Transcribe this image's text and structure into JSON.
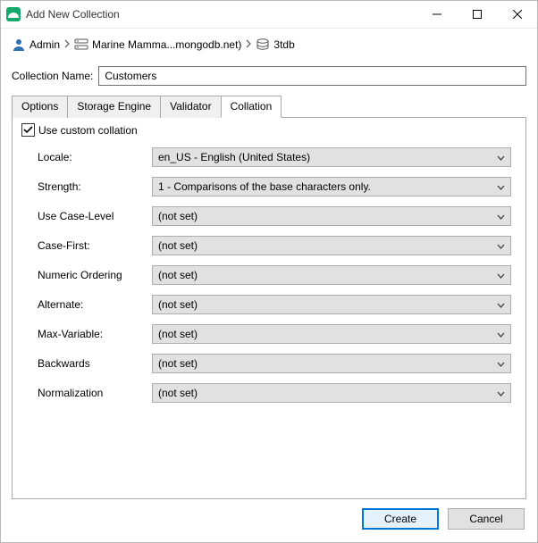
{
  "window": {
    "title": "Add New Collection"
  },
  "breadcrumb": {
    "items": [
      {
        "label": "Admin"
      },
      {
        "label": "Marine Mamma...mongodb.net)"
      },
      {
        "label": "3tdb"
      }
    ]
  },
  "collection_name": {
    "label": "Collection Name:",
    "value": "Customers"
  },
  "tabs": [
    {
      "label": "Options"
    },
    {
      "label": "Storage Engine"
    },
    {
      "label": "Validator"
    },
    {
      "label": "Collation"
    }
  ],
  "active_tab_index": 3,
  "collation": {
    "checkbox_label": "Use custom collation",
    "checked": true,
    "fields": [
      {
        "label": "Locale:",
        "value": "en_US - English (United States)"
      },
      {
        "label": "Strength:",
        "value": "1 - Comparisons of the base characters only."
      },
      {
        "label": "Use Case-Level",
        "value": "(not set)"
      },
      {
        "label": "Case-First:",
        "value": "(not set)"
      },
      {
        "label": "Numeric Ordering",
        "value": "(not set)"
      },
      {
        "label": "Alternate:",
        "value": "(not set)"
      },
      {
        "label": "Max-Variable:",
        "value": "(not set)"
      },
      {
        "label": "Backwards",
        "value": "(not set)"
      },
      {
        "label": "Normalization",
        "value": "(not set)"
      }
    ]
  },
  "footer": {
    "create_label": "Create",
    "cancel_label": "Cancel"
  }
}
